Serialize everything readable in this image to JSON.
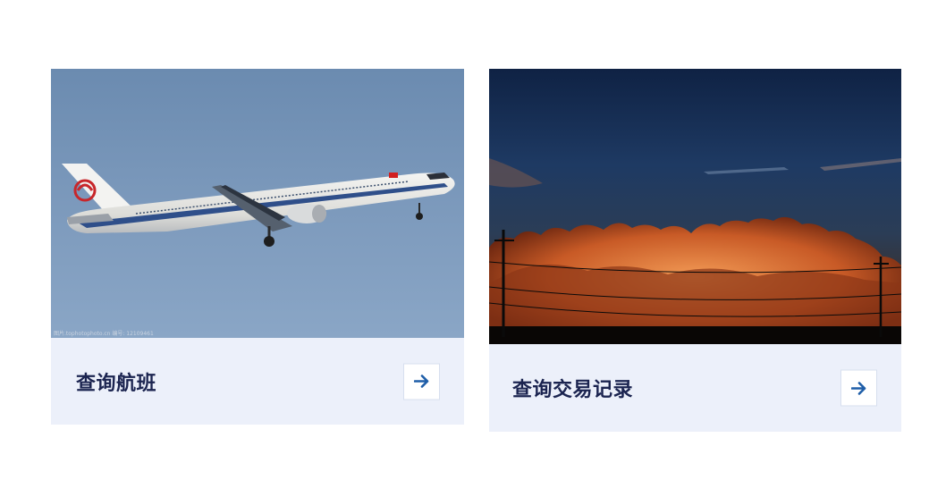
{
  "cards": [
    {
      "title": "查询航班",
      "image": "airplane-photo",
      "watermark": "图片.tophotophoto.cn  编号: 12109461",
      "arrow_icon": "arrow-right-icon"
    },
    {
      "title": "查询交易记录",
      "image": "sunset-clouds-photo",
      "arrow_icon": "arrow-right-icon"
    }
  ],
  "colors": {
    "card_footer_bg": "#ecf0fa",
    "title_text": "#1b2450",
    "arrow": "#1f5ea8"
  }
}
